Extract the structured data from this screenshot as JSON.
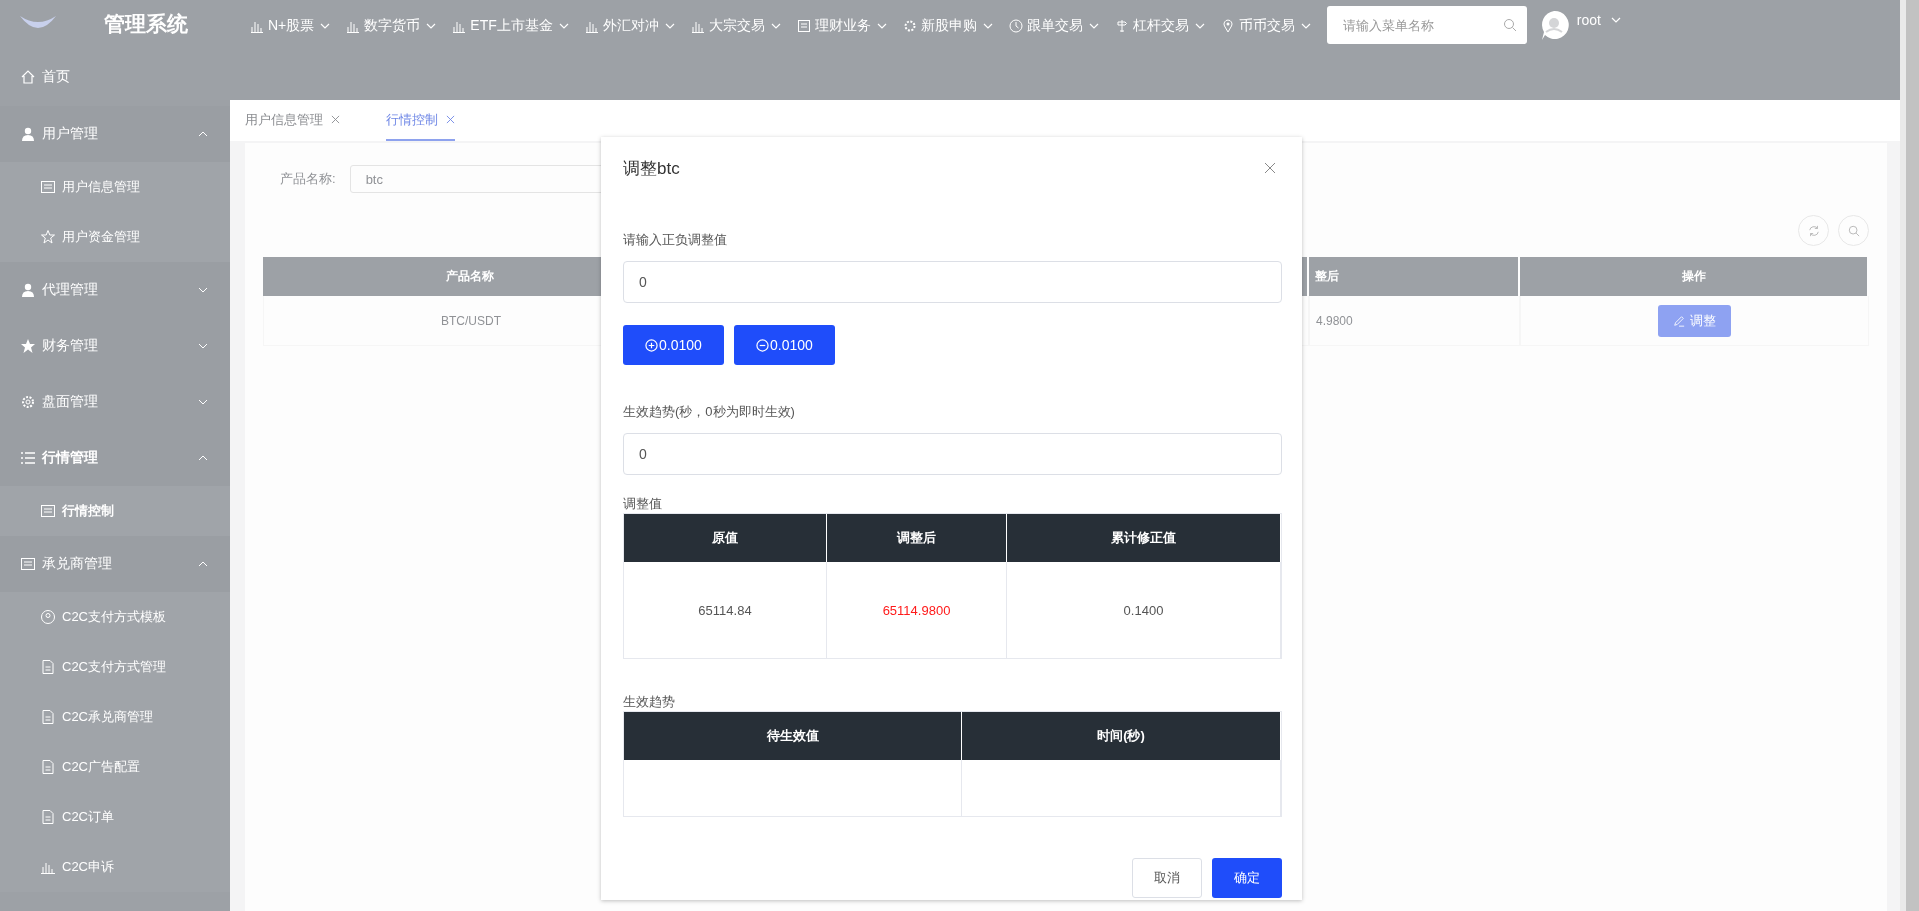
{
  "header": {
    "title": "管理系统",
    "nav": [
      {
        "label": "N+股票"
      },
      {
        "label": "数字货币"
      },
      {
        "label": "ETF上市基金"
      },
      {
        "label": "外汇对冲"
      },
      {
        "label": "大宗交易"
      },
      {
        "label": "理财业务"
      },
      {
        "label": "新股申购"
      },
      {
        "label": "跟单交易"
      },
      {
        "label": "杠杆交易"
      },
      {
        "label": "币币交易"
      }
    ],
    "search": {
      "placeholder": "请输入菜单名称"
    },
    "user": {
      "name": "root"
    }
  },
  "sidebar": {
    "items": [
      {
        "label": "首页"
      },
      {
        "label": "用户管理",
        "expanded": true,
        "children": [
          {
            "label": "用户信息管理",
            "selected": false
          },
          {
            "label": "用户资金管理",
            "selected": false
          }
        ]
      },
      {
        "label": "代理管理",
        "expanded": false
      },
      {
        "label": "财务管理",
        "expanded": false
      },
      {
        "label": "盘面管理",
        "expanded": false
      },
      {
        "label": "行情管理",
        "expanded": true,
        "children": [
          {
            "label": "行情控制",
            "selected": true
          }
        ]
      },
      {
        "label": "承兑商管理",
        "expanded": true,
        "children": [
          {
            "label": "C2C支付方式模板",
            "selected": false
          },
          {
            "label": "C2C支付方式管理",
            "selected": false
          },
          {
            "label": "C2C承兑商管理",
            "selected": false
          },
          {
            "label": "C2C广告配置",
            "selected": false
          },
          {
            "label": "C2C订单",
            "selected": false
          },
          {
            "label": "C2C申诉",
            "selected": false
          }
        ]
      }
    ]
  },
  "tabs": [
    {
      "label": "用户信息管理",
      "selected": false
    },
    {
      "label": "行情控制",
      "selected": true
    }
  ],
  "filter": {
    "label": "产品名称:",
    "value": "btc"
  },
  "table": {
    "columns": [
      "产品名称",
      "整后",
      "操作"
    ],
    "rows": [
      {
        "cells": [
          "BTC/USDT",
          "4.9800"
        ],
        "action": "调整"
      }
    ]
  },
  "dialog": {
    "title": "调整btc",
    "adjust_label": "请输入正负调整值",
    "adjust_value": "0",
    "steps": [
      {
        "kind": "plus",
        "label": "0.0100"
      },
      {
        "kind": "minus",
        "label": "0.0100"
      }
    ],
    "delay_label": "生效趋势(秒，0秒为即时生效)",
    "delay_value": "0",
    "values_title": "调整值",
    "values_table": {
      "columns": [
        "原值",
        "调整后",
        "累计修正值"
      ],
      "rows": [
        [
          {
            "text": "65114.84",
            "highlight": false
          },
          {
            "text": "65114.9800",
            "highlight": true
          },
          {
            "text": "0.1400",
            "highlight": false
          }
        ]
      ]
    },
    "trend_title": "生效趋势",
    "trend_table": {
      "columns": [
        "待生效值",
        "时间(秒)"
      ]
    },
    "buttons": [
      {
        "kind": "secondary",
        "label": "取消"
      },
      {
        "kind": "primary",
        "label": "确定"
      }
    ]
  }
}
